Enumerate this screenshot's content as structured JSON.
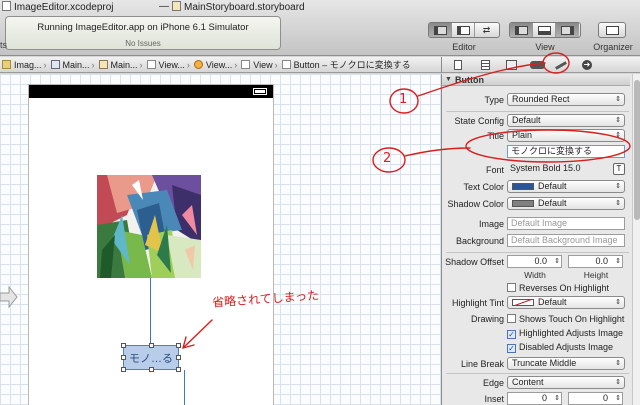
{
  "window": {
    "project_title": "ImageEditor.xcodeproj",
    "separator": "—",
    "file_title": "MainStoryboard.storyboard"
  },
  "status": {
    "message": "Running ImageEditor.app on iPhone 6.1 Simulator",
    "issues": "No Issues"
  },
  "toolbar": {
    "left_label": "ts",
    "editor_label": "Editor",
    "view_label": "View",
    "organizer_label": "Organizer"
  },
  "jumpbar": {
    "crumbs": [
      "Imag...",
      "Main...",
      "Main...",
      "View...",
      "View...",
      "View",
      "Button – モノクロに変換する"
    ]
  },
  "canvas": {
    "button_title": "モノ…る"
  },
  "inspector": {
    "section_title": "Button",
    "type": {
      "label": "Type",
      "value": "Rounded Rect"
    },
    "state_config": {
      "label": "State Config",
      "value": "Default"
    },
    "title": {
      "label": "Title",
      "value": "Plain"
    },
    "title_text": "モノクロに変換する",
    "font": {
      "label": "Font",
      "value": "System Bold 15.0",
      "button": "T"
    },
    "text_color": {
      "label": "Text Color",
      "value": "Default",
      "swatch": "#2a5599"
    },
    "shadow_color": {
      "label": "Shadow Color",
      "value": "Default",
      "swatch": "#808080"
    },
    "image": {
      "label": "Image",
      "placeholder": "Default Image"
    },
    "background": {
      "label": "Background",
      "placeholder": "Default Background Image"
    },
    "shadow_offset": {
      "label": "Shadow Offset",
      "width": "0.0",
      "height": "0.0",
      "width_label": "Width",
      "height_label": "Height"
    },
    "reverses_on_highlight": {
      "label": "Reverses On Highlight",
      "checked": false
    },
    "highlight_tint": {
      "label": "Highlight Tint",
      "value": "Default"
    },
    "drawing": {
      "label": "Drawing"
    },
    "shows_touch": {
      "label": "Shows Touch On Highlight",
      "checked": false
    },
    "highlighted_adjusts": {
      "label": "Highlighted Adjusts Image",
      "checked": true
    },
    "disabled_adjusts": {
      "label": "Disabled Adjusts Image",
      "checked": true
    },
    "line_break": {
      "label": "Line Break",
      "value": "Truncate Middle"
    },
    "edge": {
      "label": "Edge",
      "value": "Content"
    },
    "inset": {
      "label": "Inset",
      "left": "0",
      "right": "0"
    }
  },
  "annotations": {
    "marker_1": "1",
    "marker_2": "2",
    "note": "省略されてしまった",
    "color": "#d81e1e"
  }
}
